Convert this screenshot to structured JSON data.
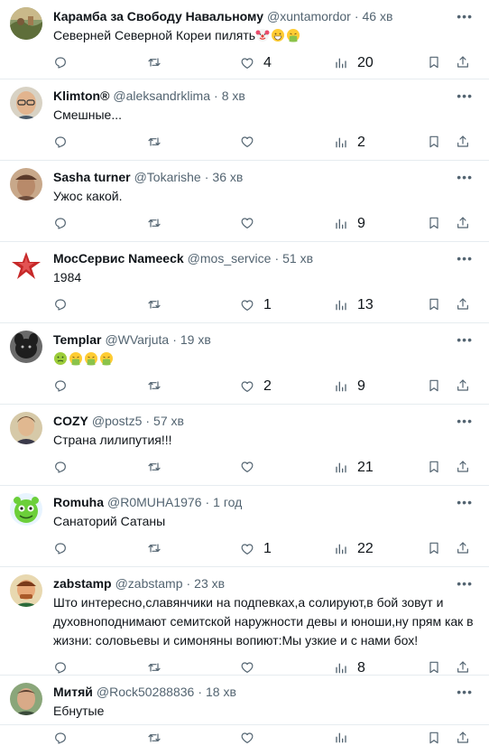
{
  "posts": [
    {
      "name": "Карамба за Свободу Навальному",
      "handle": "@xuntamordor",
      "time": "46 хв",
      "text": "Северней Северной Кореи пилять",
      "emojis": [
        "clown",
        "grin",
        "vomit"
      ],
      "replies": "",
      "retweets": "",
      "likes": "4",
      "views": "20",
      "avatar": "landscape"
    },
    {
      "name": "Klimton®",
      "handle": "@aleksandrklima",
      "time": "8 хв",
      "text": "Смешные...",
      "emojis": [],
      "replies": "",
      "retweets": "",
      "likes": "",
      "views": "2",
      "avatar": "man-glasses"
    },
    {
      "name": "Sasha turner",
      "handle": "@Tokarishe",
      "time": "36 хв",
      "text": "Ужос какой.",
      "emojis": [],
      "replies": "",
      "retweets": "",
      "likes": "",
      "views": "9",
      "avatar": "man-cap"
    },
    {
      "name": "МосСервис Nameeck",
      "handle": "@mos_service",
      "time": "51 хв",
      "text": "1984",
      "emojis": [],
      "replies": "",
      "retweets": "",
      "likes": "1",
      "views": "13",
      "avatar": "star"
    },
    {
      "name": "Templar",
      "handle": "@WVarjuta",
      "time": "19 хв",
      "text": "",
      "emojis": [
        "sick",
        "vomit",
        "vomit",
        "vomit"
      ],
      "replies": "",
      "retweets": "",
      "likes": "2",
      "views": "9",
      "avatar": "dog"
    },
    {
      "name": "COZY",
      "handle": "@postz5",
      "time": "57 хв",
      "text": "Страна лилипутия!!!",
      "emojis": [],
      "replies": "",
      "retweets": "",
      "likes": "",
      "views": "21",
      "avatar": "portrait"
    },
    {
      "name": "Romuha",
      "handle": "@R0MUHA1976",
      "time": "1 год",
      "text": "Санаторий Сатаны",
      "emojis": [],
      "replies": "",
      "retweets": "",
      "likes": "1",
      "views": "22",
      "avatar": "monster"
    },
    {
      "name": "zabstamp",
      "handle": "@zabstamp",
      "time": "23 хв",
      "text": "Што интересно,славянчики на подпевках,а солируют,в бой зовут и духовноподнимают семитской наружности девы и юноши,ну прям как в жизни: соловьевы и симоняны вопиют:Мы узкие и с нами бох!",
      "emojis": [],
      "replies": "",
      "retweets": "",
      "likes": "",
      "views": "8",
      "avatar": "cartoon-man"
    },
    {
      "name": "Митяй",
      "handle": "@Rock50288836",
      "time": "18 хв",
      "text": "Ебнутые",
      "emojis": [],
      "replies": "",
      "retweets": "",
      "likes": "",
      "views": "",
      "avatar": "man-outdoor"
    }
  ],
  "icons": {
    "reply": "reply-icon",
    "retweet": "retweet-icon",
    "like": "heart-icon",
    "views": "views-icon",
    "bookmark": "bookmark-icon",
    "share": "share-icon",
    "more": "more-icon"
  },
  "colors": {
    "text": "#0f1419",
    "secondary": "#536471",
    "divider": "#e6ecf0"
  }
}
